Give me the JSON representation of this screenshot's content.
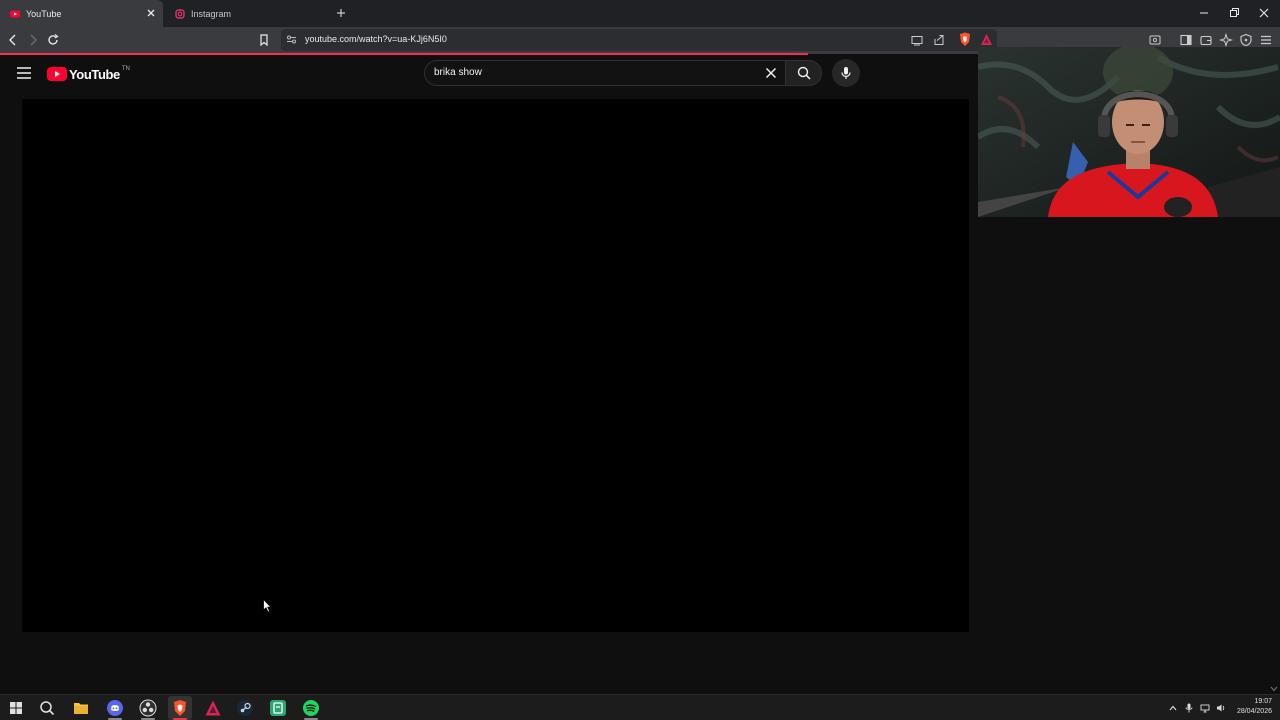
{
  "browser": {
    "tabs": [
      {
        "label": "YouTube",
        "active": true
      },
      {
        "label": "Instagram",
        "active": false
      }
    ],
    "url": "youtube.com/watch?v=ua-KJj6N5I0",
    "accent_color": "#e8344f"
  },
  "youtube": {
    "logo_text": "YouTube",
    "country_code": "TN",
    "search_value": "brika show"
  },
  "taskbar": {
    "time": "19:07",
    "date": "28/04/2026"
  }
}
